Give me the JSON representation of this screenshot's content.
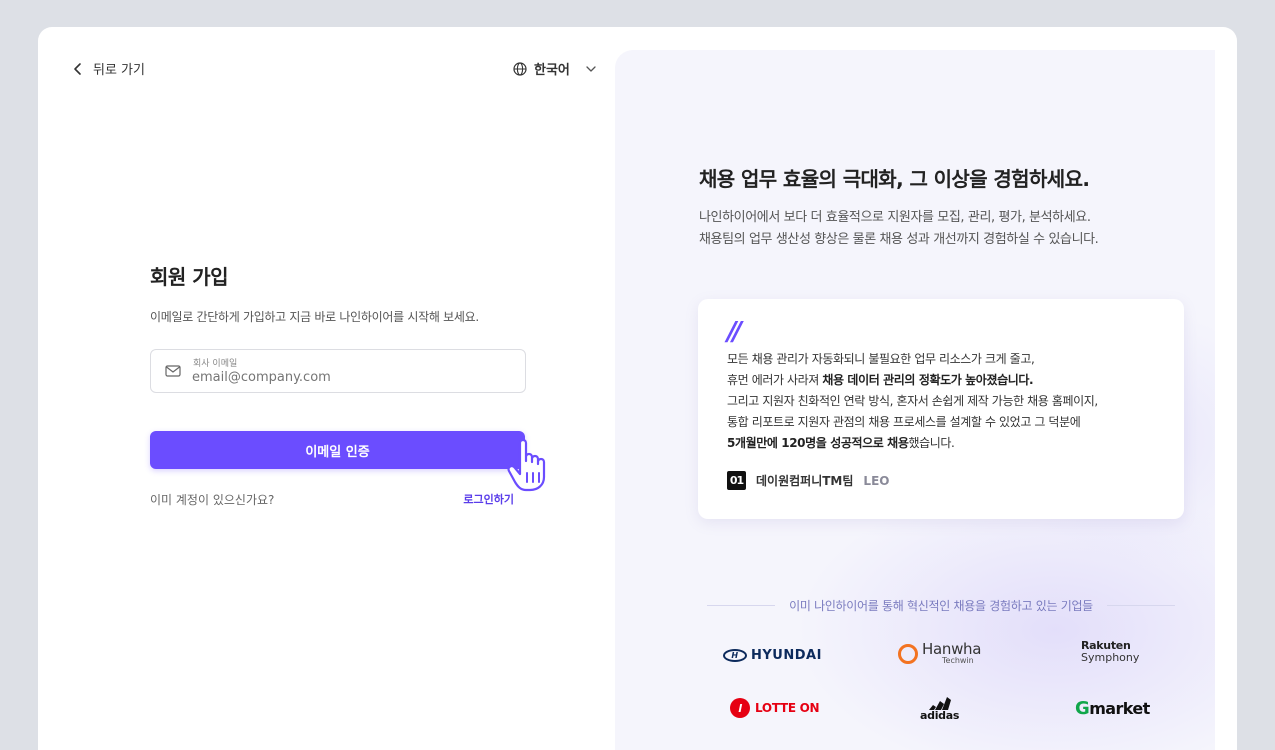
{
  "nav": {
    "back_label": "뒤로 가기",
    "language": "한국어"
  },
  "signup": {
    "title": "회원 가입",
    "subtitle": "이메일로 간단하게 가입하고 지금 바로 나인하이어를 시작해 보세요.",
    "email_label": "회사 이메일",
    "email_placeholder": "email@company.com",
    "submit_label": "이메일 인증",
    "have_account": "이미 계정이 있으신가요?",
    "login_link": "로그인하기"
  },
  "promo": {
    "headline": "채용 업무 효율의 극대화, 그 이상을 경험하세요.",
    "desc_line1": "나인하이어에서 보다 더 효율적으로 지원자를 모집, 관리, 평가, 분석하세요.",
    "desc_line2": "채용팀의 업무 생산성 향상은 물론 채용 성과 개선까지 경험하실 수 있습니다.",
    "quote_mark": "//",
    "quote_l1": "모든 채용 관리가 자동화되니 불필요한 업무 리소스가 크게 줄고,",
    "quote_l2a": "휴먼 에러가 사라져 ",
    "quote_l2b": "채용 데이터 관리의 정확도가 높아졌습니다.",
    "quote_l3": "그리고 지원자 친화적인 연락 방식, 혼자서 손쉽게 제작 가능한 채용 홈페이지,",
    "quote_l4": "통합 리포트로 지원자 관점의 채용 프로세스를 설계할 수 있었고 그 덕분에",
    "quote_l5a": "5개월만에 120명을 성공적으로 채용",
    "quote_l5b": "했습니다.",
    "author_logo": "01",
    "author_team": "데이원컴퍼니TM팀",
    "author_name": "LEO",
    "clients_title": "이미 나인하이어를 통해 혁신적인 채용을 경험하고 있는 기업들"
  },
  "client_logos": {
    "hyundai": "HYUNDAI",
    "hanwha": "Hanwha",
    "hanwha_sub": "Techwin",
    "rakuten": "Rakuten",
    "rakuten_sub": "Symphony",
    "lotte": "LOTTE ON",
    "adidas": "adidas",
    "gmarket_g": "G",
    "gmarket_rest": "market"
  },
  "colors": {
    "accent": "#6b4dff",
    "link": "#5a3dea",
    "panel_bg": "#f5f5fc"
  }
}
